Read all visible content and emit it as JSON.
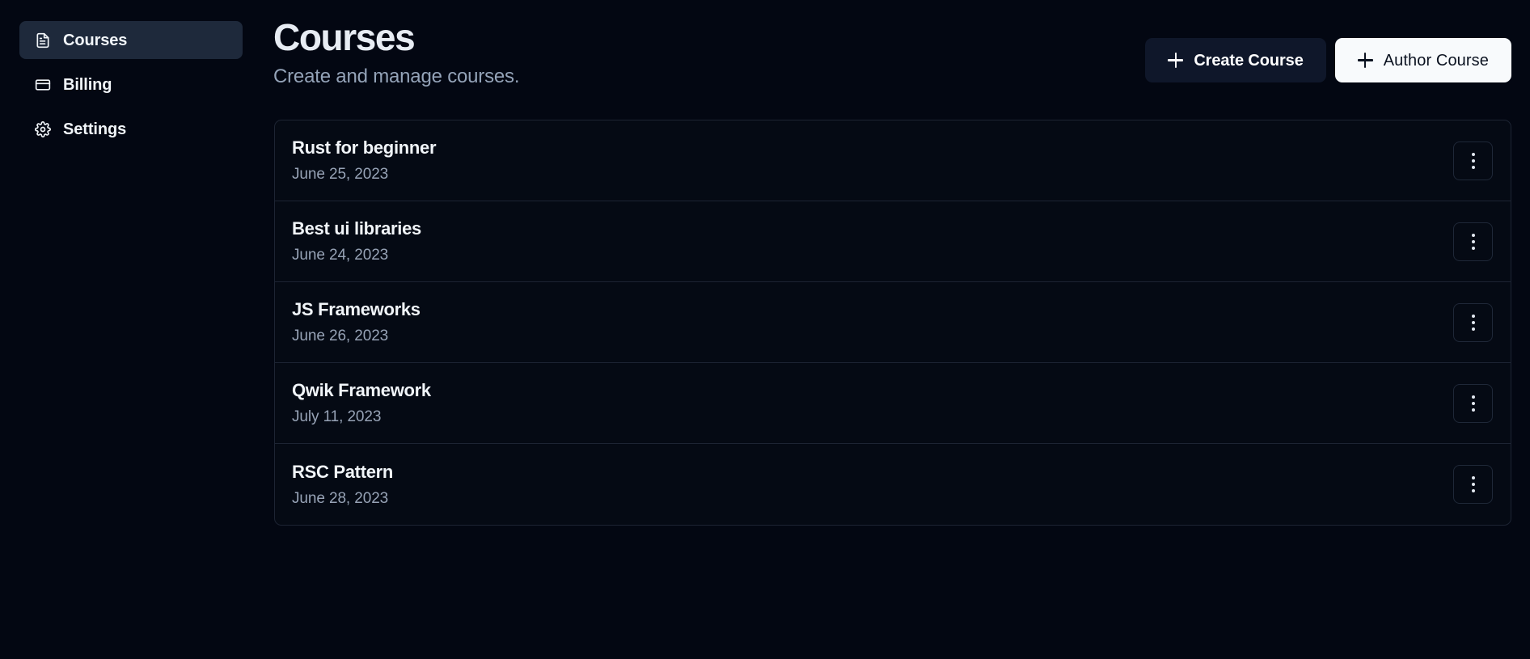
{
  "sidebar": {
    "items": [
      {
        "label": "Courses",
        "icon": "file-text-icon",
        "active": true
      },
      {
        "label": "Billing",
        "icon": "credit-card-icon",
        "active": false
      },
      {
        "label": "Settings",
        "icon": "gear-icon",
        "active": false
      }
    ]
  },
  "header": {
    "title": "Courses",
    "subtitle": "Create and manage courses.",
    "primary_button": {
      "label": "Create Course",
      "icon": "plus-icon"
    },
    "secondary_button": {
      "label": "Author Course",
      "icon": "plus-icon"
    }
  },
  "courses": [
    {
      "title": "Rust for beginner",
      "date": "June 25, 2023",
      "menu_icon": "more-vertical-icon"
    },
    {
      "title": "Best ui libraries",
      "date": "June 24, 2023",
      "menu_icon": "more-vertical-icon"
    },
    {
      "title": "JS Frameworks",
      "date": "June 26, 2023",
      "menu_icon": "more-vertical-icon"
    },
    {
      "title": "Qwik Framework",
      "date": "July 11, 2023",
      "menu_icon": "more-vertical-icon"
    },
    {
      "title": "RSC Pattern",
      "date": "June 28, 2023",
      "menu_icon": "more-vertical-icon"
    }
  ],
  "colors": {
    "background": "#030712",
    "sidebar_active": "#1e293b",
    "card_background": "#050a14",
    "border": "#1d2433",
    "text_primary": "#f1f5f9",
    "text_muted": "#94a3b8",
    "button_primary_bg": "#0f172a",
    "button_secondary_bg": "#f8fafc"
  }
}
